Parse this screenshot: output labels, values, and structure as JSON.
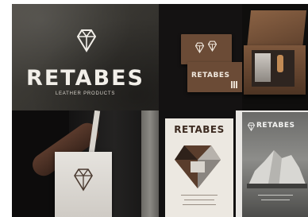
{
  "brand": {
    "name": "RETABES",
    "tagline": "LEATHER PRODUCTS"
  },
  "colors": {
    "leather_dark": "#3a3833",
    "leather_brown": "#6b4b36",
    "cream": "#ece8e1",
    "ink_brown": "#3c2a20"
  },
  "panels": [
    {
      "id": "hero",
      "content": [
        "diamond-monogram-icon",
        "brand.name",
        "brand.tagline"
      ]
    },
    {
      "id": "business-cards",
      "content": [
        "diamond-monogram-icon",
        "brand.name"
      ]
    },
    {
      "id": "packaging-box"
    },
    {
      "id": "tote-bag",
      "content": [
        "diamond-monogram-icon"
      ]
    },
    {
      "id": "poster",
      "content": [
        "brand.name"
      ]
    },
    {
      "id": "iceberg-poster",
      "content": [
        "diamond-monogram-icon",
        "brand.name"
      ]
    }
  ]
}
